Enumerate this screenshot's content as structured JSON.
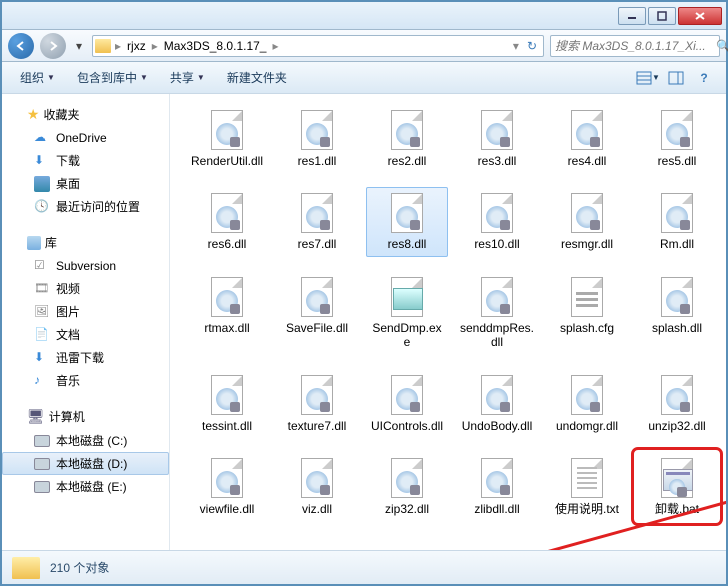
{
  "breadcrumb": {
    "p1": "rjxz",
    "p2": "Max3DS_8.0.1.17_"
  },
  "search": {
    "placeholder": "搜索 Max3DS_8.0.1.17_Xi..."
  },
  "toolbar": {
    "organize": "组织",
    "include": "包含到库中",
    "share": "共享",
    "newfolder": "新建文件夹"
  },
  "sidebar": {
    "favorites": "收藏夹",
    "fav": {
      "onedrive": "OneDrive",
      "downloads": "下载",
      "desktop": "桌面",
      "recent": "最近访问的位置"
    },
    "libraries": "库",
    "lib": {
      "subversion": "Subversion",
      "videos": "视频",
      "pictures": "图片",
      "documents": "文档",
      "xunlei": "迅雷下载",
      "music": "音乐"
    },
    "computer": "计算机",
    "drives": {
      "c": "本地磁盘 (C:)",
      "d": "本地磁盘 (D:)",
      "e": "本地磁盘 (E:)"
    }
  },
  "files": [
    {
      "name": "RenderUtil.dll",
      "type": "dll"
    },
    {
      "name": "res1.dll",
      "type": "dll"
    },
    {
      "name": "res2.dll",
      "type": "dll"
    },
    {
      "name": "res3.dll",
      "type": "dll"
    },
    {
      "name": "res4.dll",
      "type": "dll"
    },
    {
      "name": "res5.dll",
      "type": "dll"
    },
    {
      "name": "res6.dll",
      "type": "dll"
    },
    {
      "name": "res7.dll",
      "type": "dll"
    },
    {
      "name": "res8.dll",
      "type": "dll",
      "selected": true
    },
    {
      "name": "res10.dll",
      "type": "dll"
    },
    {
      "name": "resmgr.dll",
      "type": "dll"
    },
    {
      "name": "Rm.dll",
      "type": "dll"
    },
    {
      "name": "rtmax.dll",
      "type": "dll"
    },
    {
      "name": "SaveFile.dll",
      "type": "dll"
    },
    {
      "name": "SendDmp.exe",
      "type": "exe"
    },
    {
      "name": "senddmpRes.dll",
      "type": "dll"
    },
    {
      "name": "splash.cfg",
      "type": "cfg"
    },
    {
      "name": "splash.dll",
      "type": "dll"
    },
    {
      "name": "tessint.dll",
      "type": "dll"
    },
    {
      "name": "texture7.dll",
      "type": "dll"
    },
    {
      "name": "UIControls.dll",
      "type": "dll"
    },
    {
      "name": "UndoBody.dll",
      "type": "dll"
    },
    {
      "name": "undomgr.dll",
      "type": "dll"
    },
    {
      "name": "unzip32.dll",
      "type": "dll"
    },
    {
      "name": "viewfile.dll",
      "type": "dll"
    },
    {
      "name": "viz.dll",
      "type": "dll"
    },
    {
      "name": "zip32.dll",
      "type": "dll"
    },
    {
      "name": "zlibdll.dll",
      "type": "dll"
    },
    {
      "name": "使用说明.txt",
      "type": "txt"
    },
    {
      "name": "卸载.bat",
      "type": "bat",
      "highlighted": true
    }
  ],
  "status": {
    "count": "210 个对象"
  }
}
